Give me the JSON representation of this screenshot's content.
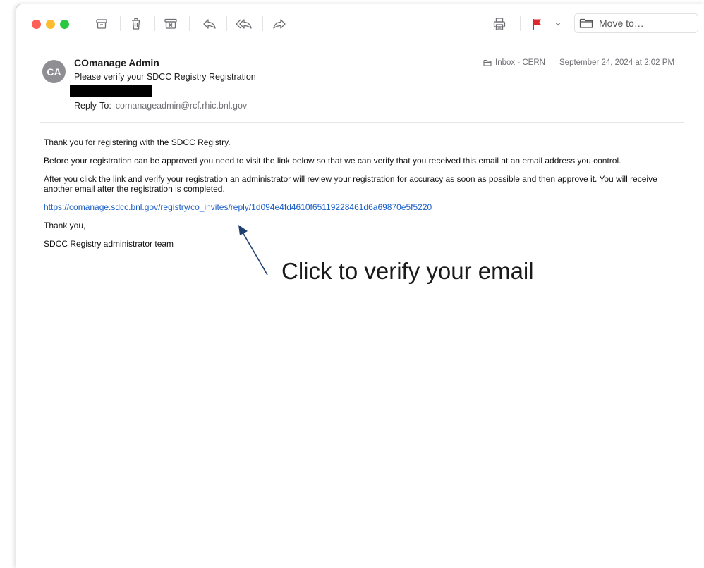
{
  "toolbar": {
    "move_to_label": "Move to…",
    "icons": [
      "archive-icon",
      "trash-icon",
      "junk-icon",
      "reply-icon",
      "reply-all-icon",
      "forward-icon",
      "print-icon",
      "flag-icon",
      "chevron-down-icon",
      "folder-icon"
    ],
    "flag_color": "#e0262b"
  },
  "message": {
    "avatar_initials": "CA",
    "sender": "COmanage Admin",
    "subject": "Please verify your SDCC Registry Registration",
    "reply_to_label": "Reply-To:",
    "reply_to_address": "comanageadmin@rcf.rhic.bnl.gov",
    "mailbox": "Inbox - CERN",
    "date": "September 24, 2024 at 2:02 PM"
  },
  "body": {
    "p1": "Thank you for registering with the SDCC Registry.",
    "p2": "Before your registration can be approved you need to visit the link below so that we can verify that you received this email at an email address you control.",
    "p3": "After you click the link and verify your registration an administrator will review your registration for accuracy as soon as possible and then approve it. You will receive another email after the registration is completed.",
    "link": "https://comanage.sdcc.bnl.gov/registry/co_invites/reply/1d094e4fd4610f65119228461d6a69870e5f5220",
    "p4": "Thank you,",
    "p5": "SDCC Registry administrator team"
  },
  "annotation": {
    "text": "Click to verify your email",
    "arrow_color": "#1f3f6e"
  }
}
